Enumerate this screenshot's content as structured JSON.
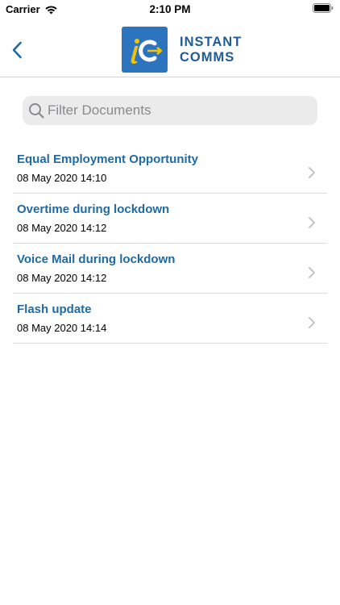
{
  "status_bar": {
    "carrier": "Carrier",
    "time": "2:10 PM"
  },
  "header": {
    "brand_line1": "INSTANT",
    "brand_line2": "COMMS"
  },
  "search": {
    "placeholder": "Filter Documents",
    "value": ""
  },
  "documents": [
    {
      "title": "Equal Employment Opportunity",
      "date": "08 May 2020 14:10"
    },
    {
      "title": "Overtime during lockdown",
      "date": "08 May 2020 14:12"
    },
    {
      "title": "Voice Mail during lockdown",
      "date": "08 May 2020 14:12"
    },
    {
      "title": "Flash update",
      "date": "08 May 2020 14:14"
    }
  ],
  "colors": {
    "accent": "#1f6aa3",
    "brand_blue": "#2c74bd",
    "brand_yellow": "#f5c400"
  },
  "icons": [
    "wifi-icon",
    "battery-icon",
    "back-chevron-icon",
    "search-icon",
    "chevron-right-icon"
  ]
}
